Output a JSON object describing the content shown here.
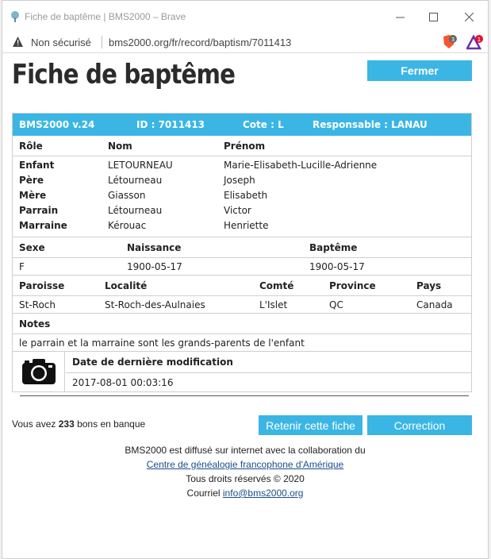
{
  "browser": {
    "window_title": "Fiche de baptême | BMS2000 – Brave",
    "security_label": "Non sécurisé",
    "url": "bms2000.org/fr/record/baptism/7011413",
    "shield_count": "3",
    "rewards_count": "1"
  },
  "page": {
    "title": "Fiche de baptême",
    "close_label": "Fermer"
  },
  "record": {
    "header": {
      "version": "BMS2000 v.24",
      "id": "ID : 7011413",
      "cote": "Cote : L",
      "responsable": "Responsable : LANAU"
    },
    "people_columns": [
      "Rôle",
      "Nom",
      "Prénom"
    ],
    "people": [
      {
        "role": "Enfant",
        "nom": "LETOURNEAU",
        "prenom": "Marie-Elisabeth-Lucille-Adrienne"
      },
      {
        "role": "Père",
        "nom": "Létourneau",
        "prenom": "Joseph"
      },
      {
        "role": "Mère",
        "nom": "Giasson",
        "prenom": "Elisabeth"
      },
      {
        "role": "Parrain",
        "nom": "Létourneau",
        "prenom": "Victor"
      },
      {
        "role": "Marraine",
        "nom": "Kérouac",
        "prenom": "Henriette"
      }
    ],
    "dates_columns": [
      "Sexe",
      "Naissance",
      "Baptême"
    ],
    "dates": {
      "sexe": "F",
      "naissance": "1900-05-17",
      "bapteme": "1900-05-17"
    },
    "place_columns": [
      "Paroisse",
      "Localité",
      "Comté",
      "Province",
      "Pays"
    ],
    "place": {
      "paroisse": "St-Roch",
      "localite": "St-Roch-des-Aulnaies",
      "comte": "L'Islet",
      "province": "QC",
      "pays": "Canada"
    },
    "notes_label": "Notes",
    "notes": "le parrain et la marraine sont les grands-parents de l'enfant",
    "modification_label": "Date de dernière modification",
    "modification_date": "2017-08-01 00:03:16"
  },
  "bank": {
    "prefix": "Vous avez ",
    "count": "233",
    "suffix": " bons en banque"
  },
  "actions": {
    "keep_label": "Retenir cette fiche",
    "correction_label": "Correction"
  },
  "footer": {
    "line1": "BMS2000 est diffusé sur internet avec la collaboration du",
    "link1": "Centre de généalogie francophone d'Amérique",
    "line3": "Tous droits réservés © 2020",
    "line4_prefix": "Courriel ",
    "email": "info@bms2000.org"
  },
  "colors": {
    "accent": "#3bb6e4",
    "link": "#1a4e8a"
  }
}
